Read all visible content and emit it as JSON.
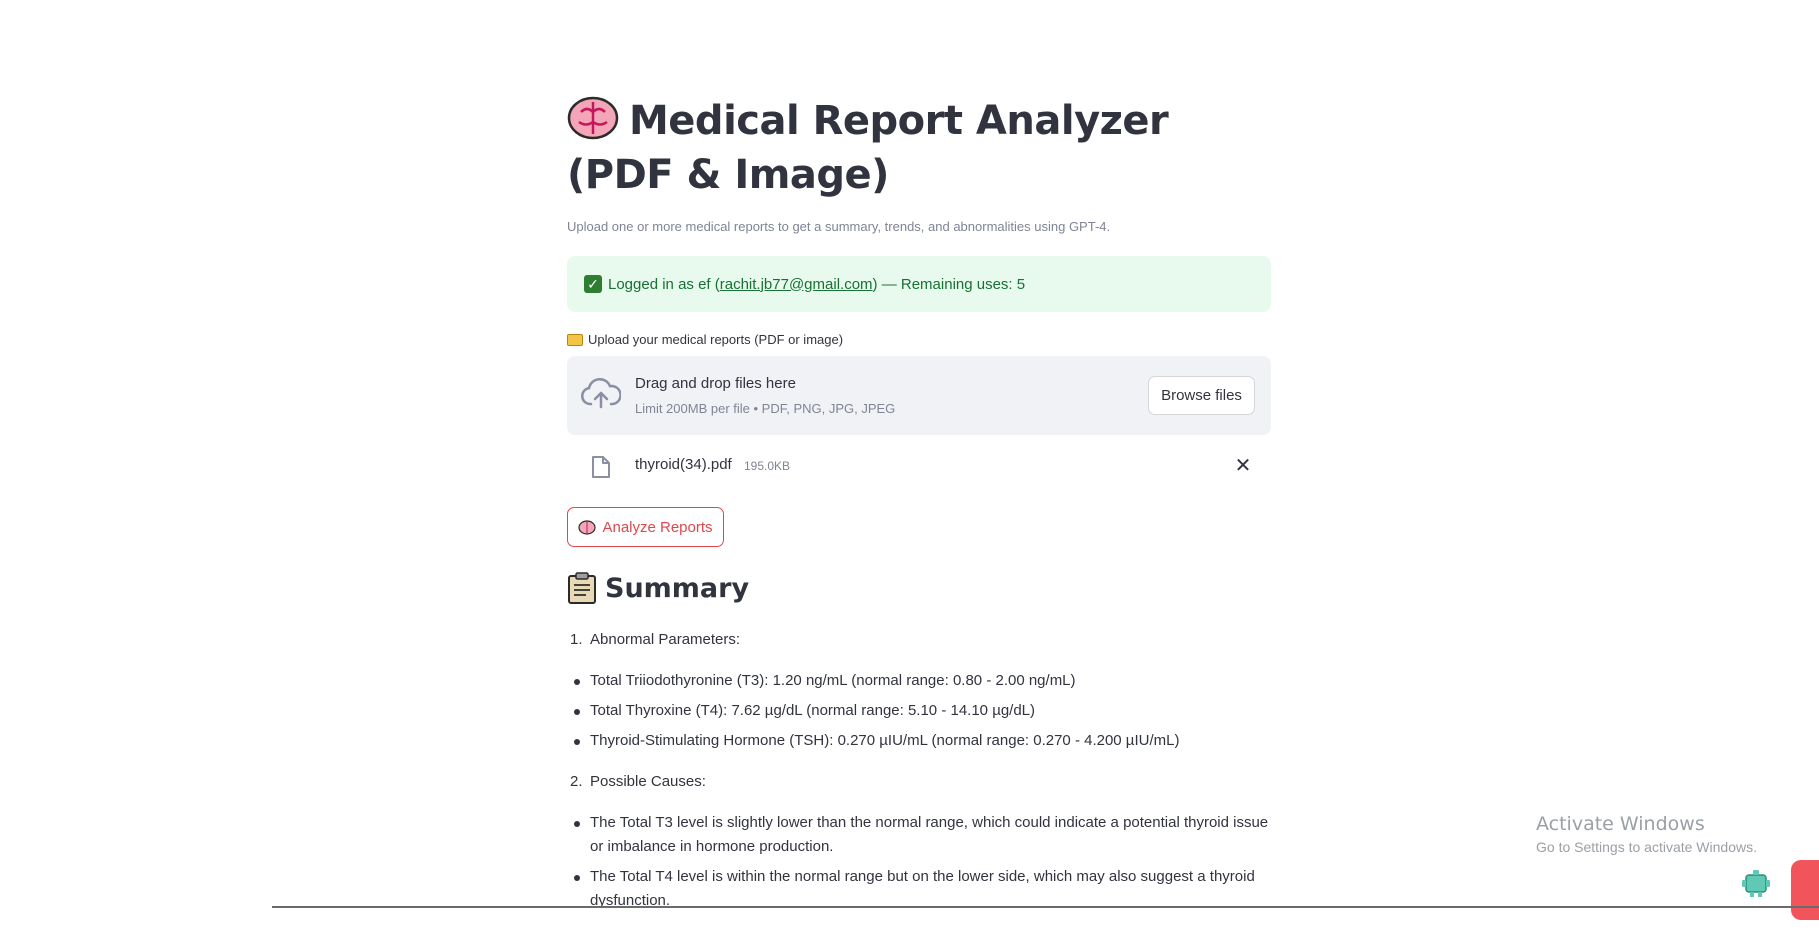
{
  "app": {
    "title": "Medical Report Analyzer (PDF & Image)",
    "subtitle": "Upload one or more medical reports to get a summary, trends, and abnormalities using GPT-4."
  },
  "status": {
    "prefix": "Logged in as ef (",
    "email": "rachit.jb77@gmail.com",
    "suffix": ") — Remaining uses: 5",
    "color": "#177233"
  },
  "uploader": {
    "label": "Upload your medical reports (PDF or image)",
    "drop_title": "Drag and drop files here",
    "drop_limit": "Limit 200MB per file • PDF, PNG, JPG, JPEG",
    "browse_label": "Browse files",
    "files": [
      {
        "name": "thyroid(34).pdf",
        "size": "195.0KB"
      }
    ]
  },
  "analyze_button": {
    "label": "Analyze Reports",
    "color": "#e0474c"
  },
  "summary": {
    "heading": "Summary",
    "sections": [
      {
        "number": "1.",
        "title": "Abnormal Parameters:",
        "bullets": [
          "Total Triiodothyronine (T3): 1.20 ng/mL (normal range: 0.80 - 2.00 ng/mL)",
          "Total Thyroxine (T4): 7.62 µg/dL (normal range: 5.10 - 14.10 µg/dL)",
          "Thyroid-Stimulating Hormone (TSH): 0.270 µIU/mL (normal range: 0.270 - 4.200 µIU/mL)"
        ]
      },
      {
        "number": "2.",
        "title": "Possible Causes:",
        "bullets": [
          "The Total T3 level is slightly lower than the normal range, which could indicate a potential thyroid issue or imbalance in hormone production.",
          "The Total T4 level is within the normal range but on the lower side, which may also suggest a thyroid dysfunction."
        ]
      }
    ]
  },
  "watermark": {
    "title": "Activate Windows",
    "subtitle": "Go to Settings to activate Windows."
  }
}
